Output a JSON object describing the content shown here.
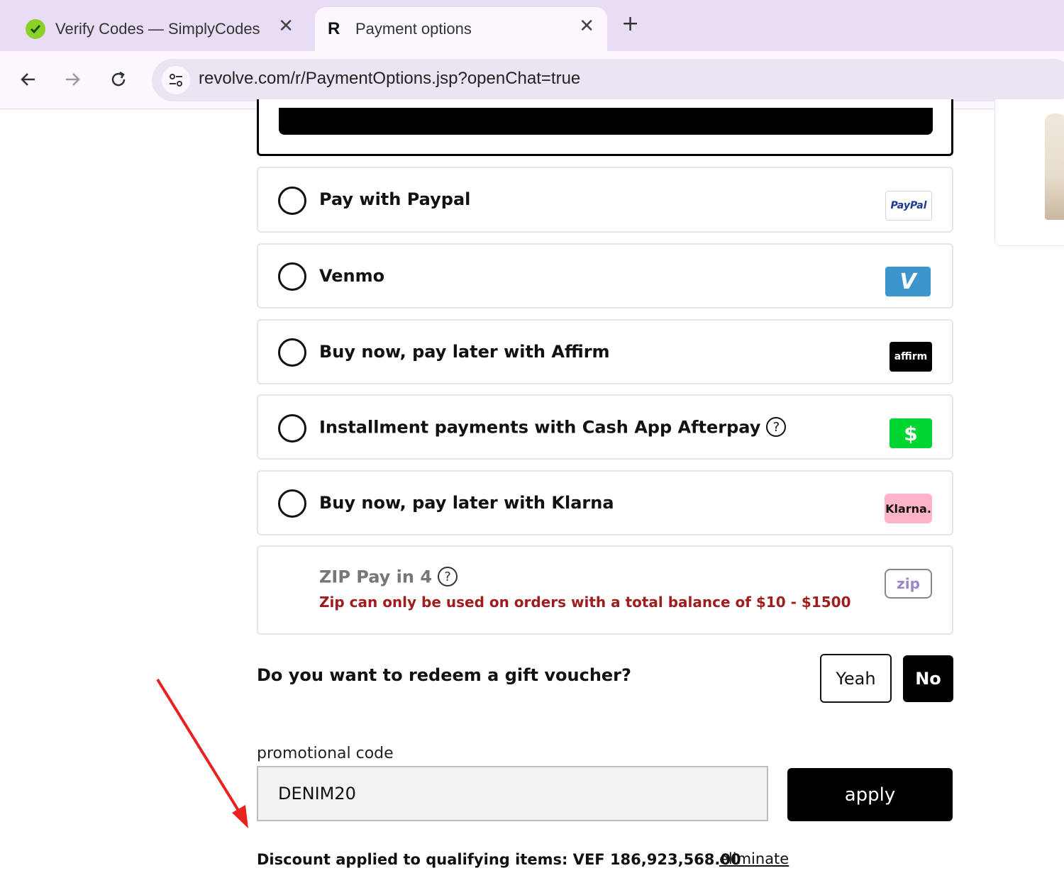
{
  "browser": {
    "tabs": [
      {
        "title": "Verify Codes — SimplyCodes",
        "favicon": "simplycodes-icon",
        "active": false
      },
      {
        "title": "Payment options",
        "favicon": "R",
        "active": true
      }
    ],
    "url": "revolve.com/r/PaymentOptions.jsp?openChat=true"
  },
  "payment_options": [
    {
      "label": "Pay with Paypal",
      "logo_text": "PayPal",
      "logo": "paypal-logo"
    },
    {
      "label": "Venmo",
      "logo_text": "V",
      "logo": "venmo-logo",
      "color": "#3d95ce"
    },
    {
      "label": "Buy now, pay later with Affirm",
      "logo_text": "affirm",
      "logo": "affirm-logo"
    },
    {
      "label": "Installment payments with Cash App Afterpay",
      "logo_text": "$",
      "logo": "cashapp-logo",
      "color": "#00d632"
    },
    {
      "label": "Buy now, pay later with Klarna",
      "logo_text": "Klarna.",
      "logo": "klarna-logo",
      "color": "#ffb3c7"
    }
  ],
  "zip": {
    "title": "ZIP Pay in 4",
    "note": "Zip can only be used on orders with a total balance of $10 - $1500",
    "logo_text": "zip",
    "note_color": "#a11d1d"
  },
  "voucher": {
    "question": "Do you want to redeem a gift voucher?",
    "yes_label": "Yeah",
    "no_label": "No"
  },
  "promo": {
    "label": "promotional code",
    "value": "DENIM20",
    "apply_label": "apply"
  },
  "discount": {
    "text": "Discount applied to qualifying items: VEF 186,923,568.00",
    "remove_label": "eliminate"
  },
  "annotation": {
    "arrow_color": "#e8231f"
  }
}
